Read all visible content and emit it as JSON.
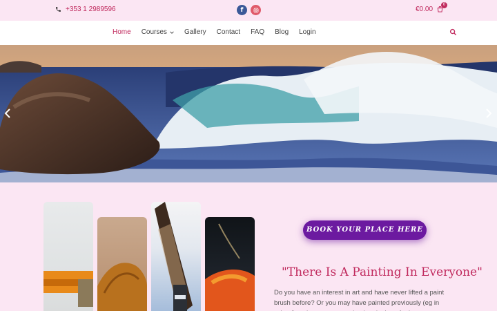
{
  "topbar": {
    "phone": "+353 1 2989596",
    "cart_total": "€0.00",
    "cart_count": "0"
  },
  "nav": {
    "items": [
      {
        "label": "Home",
        "active": true
      },
      {
        "label": "Courses",
        "has_dropdown": true
      },
      {
        "label": "Gallery"
      },
      {
        "label": "Contact"
      },
      {
        "label": "FAQ"
      },
      {
        "label": "Blog"
      },
      {
        "label": "Login"
      }
    ]
  },
  "content": {
    "button_label": "BOOK YOUR PLACE HERE",
    "headline": "\"There Is A Painting In Everyone\"",
    "paragraph": "Do you have an interest in art and have never lifted a paint brush before? Or you may have painted previously (eg in school) and want to try again, then look no further"
  },
  "colors": {
    "accent": "#c0295d",
    "button": "#6c1aa0",
    "background": "#fbe6f3"
  },
  "icons": [
    "phone-icon",
    "facebook-icon",
    "instagram-icon",
    "cart-icon",
    "chevron-down-icon",
    "search-icon",
    "arrow-left-icon",
    "arrow-right-icon"
  ]
}
